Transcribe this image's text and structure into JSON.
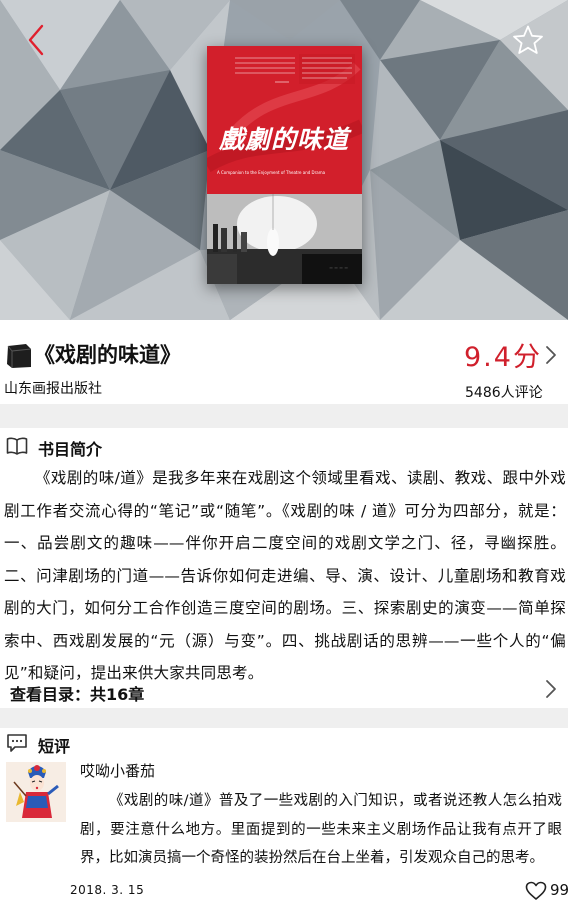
{
  "header": {
    "back_icon": "chevron-left-icon",
    "favorite_icon": "star-outline-icon"
  },
  "cover": {
    "title": "戲劇的味道",
    "subtitle": "A Companion to the Enjoyment of Theatre and Drama",
    "colors": {
      "red": "#d21f2b",
      "photo": "#d6d6d6"
    }
  },
  "book": {
    "title": "《戏剧的味道》",
    "publisher": "山东画报出版社",
    "score": "9.4分",
    "review_count": "5486人评论",
    "accent_color": "#d0202c"
  },
  "intro": {
    "heading": "书目简介",
    "text": "《戏剧的味/道》是我多年来在戏剧这个领域里看戏、读剧、教戏、跟中外戏剧工作者交流心得的“笔记”或“随笔”。《戏剧的味 / 道》可分为四部分，就是：一、品尝剧文的趣味——伴你开启二度空间的戏剧文学之门、径，寻幽探胜。二、问津剧场的门道——告诉你如何走进编、导、演、设计、儿童剧场和教育戏剧的大门，如何分工合作创造三度空间的剧场。三、探索剧史的演变——简单探索中、西戏剧发展的“元（源）与变”。四、挑战剧话的思辨——一些个人的“偏见”和疑问，提出来供大家共同思考。"
  },
  "toc": {
    "label": "查看目录：共16章"
  },
  "reviews": {
    "heading": "短评",
    "items": [
      {
        "user": "哎呦小番茄",
        "text": "《戏剧的味/道》普及了一些戏剧的入门知识，或者说还教人怎么拍戏剧，要注意什么地方。里面提到的一些未来主义剧场作品让我有点开了眼界，比如演员搞一个奇怪的装扮然后在台上坐着，引发观众自己的思考。",
        "date": "2018. 3. 15",
        "likes": "99"
      }
    ]
  }
}
